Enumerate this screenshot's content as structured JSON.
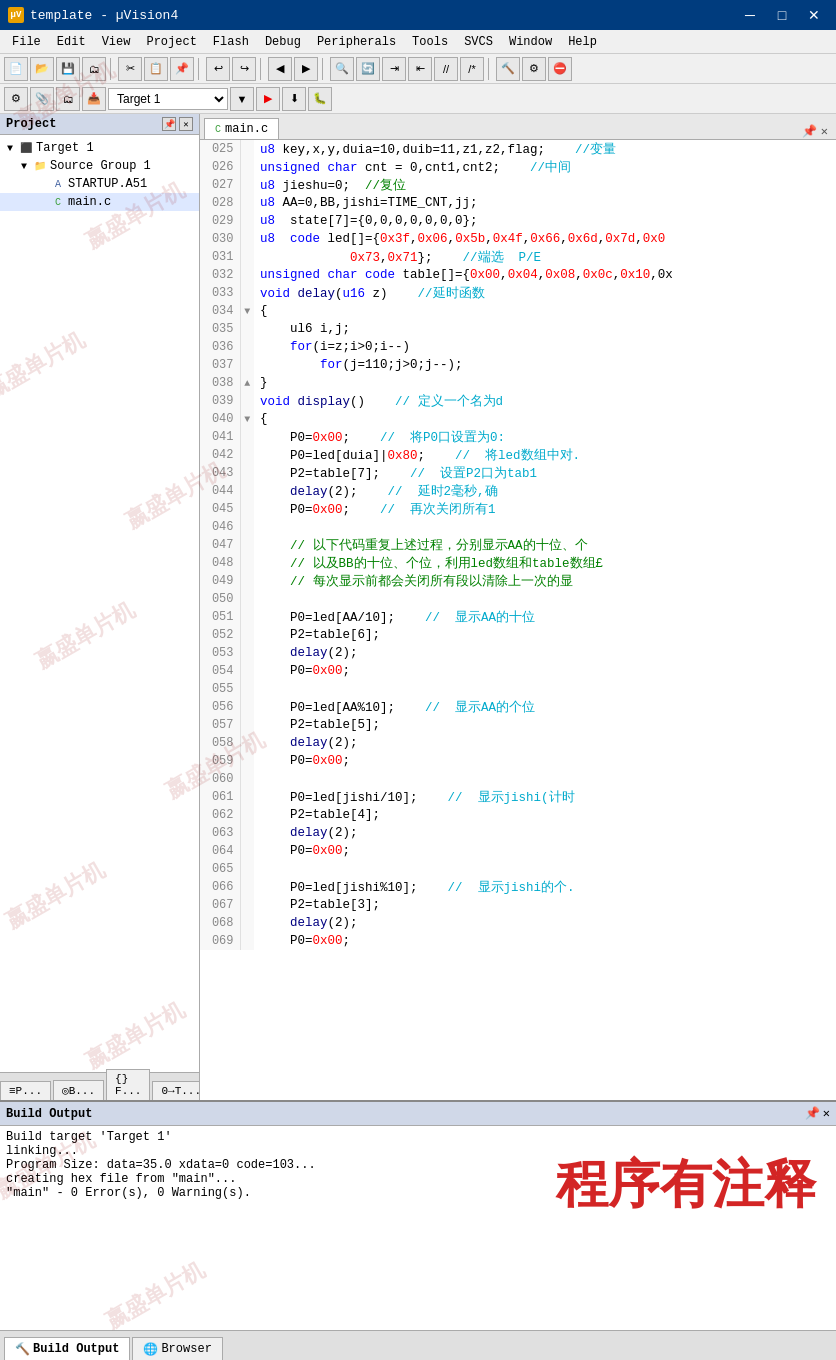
{
  "window": {
    "title": "template - µVision4",
    "icon_label": "µV"
  },
  "menu": {
    "items": [
      "File",
      "Edit",
      "View",
      "Project",
      "Flash",
      "Debug",
      "Peripherals",
      "Tools",
      "SVCS",
      "Window",
      "Help"
    ]
  },
  "toolbar2": {
    "target_label": "Target 1"
  },
  "project_panel": {
    "title": "Project",
    "tree": [
      {
        "level": 0,
        "expand": "▼",
        "icon": "target",
        "label": "Target 1"
      },
      {
        "level": 1,
        "expand": "▼",
        "icon": "folder",
        "label": "Source Group 1"
      },
      {
        "level": 2,
        "expand": " ",
        "icon": "asm",
        "label": "STARTUP.A51"
      },
      {
        "level": 2,
        "expand": " ",
        "icon": "c",
        "label": "main.c"
      }
    ],
    "bottom_tabs": [
      {
        "label": "≡P...",
        "active": false
      },
      {
        "label": "◎B...",
        "active": false
      },
      {
        "label": "{} F...",
        "active": false
      },
      {
        "label": "0→T...",
        "active": false
      }
    ]
  },
  "editor": {
    "tab_label": "main.c",
    "lines": [
      {
        "num": "025",
        "expand": "",
        "code": "u8 key,x,y,duia=10,duib=11,z1,z2,flag;",
        "comment": "//变量"
      },
      {
        "num": "026",
        "expand": "",
        "code": "unsigned char cnt = 0,cnt1,cnt2;",
        "comment": "//中间"
      },
      {
        "num": "027",
        "expand": "",
        "code": "u8 jieshu=0;  //复位",
        "comment": ""
      },
      {
        "num": "028",
        "expand": "",
        "code": "u8 AA=0,BB,jishi=TIME_CNT,jj;",
        "comment": ""
      },
      {
        "num": "029",
        "expand": "",
        "code": "u8  state[7]={0,0,0,0,0,0,0};",
        "comment": ""
      },
      {
        "num": "030",
        "expand": "",
        "code": "u8  code led[]={0x3f,0x06,0x5b,0x4f,0x66,0x6d,0x7d,0x0",
        "comment": ""
      },
      {
        "num": "031",
        "expand": "",
        "code": "            0x73,0x71};",
        "comment": "//端选  P/E"
      },
      {
        "num": "032",
        "expand": "",
        "code": "unsigned char code table[]={0x00,0x04,0x08,0x0c,0x10,0x",
        "comment": ""
      },
      {
        "num": "033",
        "expand": "",
        "code": "void delay(u16 z)",
        "comment": "//延时函数"
      },
      {
        "num": "034",
        "expand": "▼",
        "code": "{",
        "comment": ""
      },
      {
        "num": "035",
        "expand": "",
        "code": "    ul6 i,j;",
        "comment": ""
      },
      {
        "num": "036",
        "expand": "",
        "code": "    for(i=z;i>0;i--)",
        "comment": ""
      },
      {
        "num": "037",
        "expand": "",
        "code": "        for(j=110;j>0;j--);",
        "comment": ""
      },
      {
        "num": "038",
        "expand": "▲",
        "code": "}",
        "comment": ""
      },
      {
        "num": "039",
        "expand": "",
        "code": "void display()",
        "comment": "// 定义一个名为d"
      },
      {
        "num": "040",
        "expand": "▼",
        "code": "{",
        "comment": ""
      },
      {
        "num": "041",
        "expand": "",
        "code": "    P0=0x00;",
        "comment": "//  将P0口设置为0:"
      },
      {
        "num": "042",
        "expand": "",
        "code": "    P0=led[duia]|0x80;",
        "comment": "//  将led数组中对."
      },
      {
        "num": "043",
        "expand": "",
        "code": "    P2=table[7];",
        "comment": "//  设置P2口为tab1"
      },
      {
        "num": "044",
        "expand": "",
        "code": "    delay(2);",
        "comment": "//  延时2毫秒,确"
      },
      {
        "num": "045",
        "expand": "",
        "code": "    P0=0x00;",
        "comment": "//  再次关闭所有1"
      },
      {
        "num": "046",
        "expand": "",
        "code": "",
        "comment": ""
      },
      {
        "num": "047",
        "expand": "",
        "code": "    // 以下代码重复上述过程，分别显示AA的十位、个",
        "comment": ""
      },
      {
        "num": "048",
        "expand": "",
        "code": "    // 以及BB的十位、个位，利用led数组和table数组£",
        "comment": ""
      },
      {
        "num": "049",
        "expand": "",
        "code": "    // 每次显示前都会关闭所有段以清除上一次的显",
        "comment": ""
      },
      {
        "num": "050",
        "expand": "",
        "code": "",
        "comment": ""
      },
      {
        "num": "051",
        "expand": "",
        "code": "    P0=led[AA/10];",
        "comment": "//  显示AA的十位"
      },
      {
        "num": "052",
        "expand": "",
        "code": "    P2=table[6];",
        "comment": ""
      },
      {
        "num": "053",
        "expand": "",
        "code": "    delay(2);",
        "comment": ""
      },
      {
        "num": "054",
        "expand": "",
        "code": "    P0=0x00;",
        "comment": ""
      },
      {
        "num": "055",
        "expand": "",
        "code": "",
        "comment": ""
      },
      {
        "num": "056",
        "expand": "",
        "code": "    P0=led[AA%10];",
        "comment": "//  显示AA的个位"
      },
      {
        "num": "057",
        "expand": "",
        "code": "    P2=table[5];",
        "comment": ""
      },
      {
        "num": "058",
        "expand": "",
        "code": "    delay(2);",
        "comment": ""
      },
      {
        "num": "059",
        "expand": "",
        "code": "    P0=0x00;",
        "comment": ""
      },
      {
        "num": "060",
        "expand": "",
        "code": "",
        "comment": ""
      },
      {
        "num": "061",
        "expand": "",
        "code": "    P0=led[jishi/10];",
        "comment": "//  显示jishi(计时"
      },
      {
        "num": "062",
        "expand": "",
        "code": "    P2=table[4];",
        "comment": ""
      },
      {
        "num": "063",
        "expand": "",
        "code": "    delay(2);",
        "comment": ""
      },
      {
        "num": "064",
        "expand": "",
        "code": "    P0=0x00;",
        "comment": ""
      },
      {
        "num": "065",
        "expand": "",
        "code": "",
        "comment": ""
      },
      {
        "num": "066",
        "expand": "",
        "code": "    P0=led[jishi%10];",
        "comment": "//  显示jishi的个."
      },
      {
        "num": "067",
        "expand": "",
        "code": "    P2=table[3];",
        "comment": ""
      },
      {
        "num": "068",
        "expand": "",
        "code": "    delay(2);",
        "comment": ""
      },
      {
        "num": "069",
        "expand": "",
        "code": "    P0=0x00;",
        "comment": ""
      }
    ]
  },
  "build_output": {
    "title": "Build Output",
    "lines": [
      "Build target 'Target 1'",
      "linking...",
      "Program Size: data=35.0 xdata=0 code=103...",
      "creating hex file from \"main\"...",
      "\"main\" - 0 Error(s), 0 Warning(s)."
    ]
  },
  "bottom_tabs": [
    {
      "label": "Build Output",
      "active": true,
      "icon": "build"
    },
    {
      "label": "Browser",
      "active": false,
      "icon": "browse"
    }
  ],
  "watermark": {
    "text": "嬴盛单片机",
    "big_text": "程序有注释"
  }
}
